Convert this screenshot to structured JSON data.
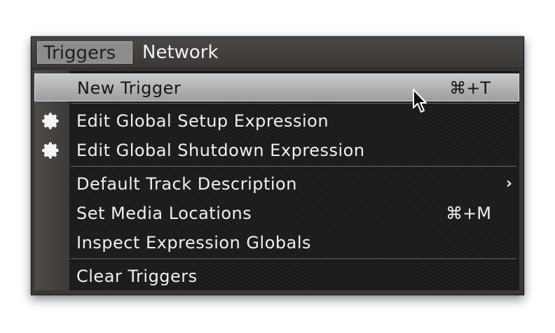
{
  "menubar": {
    "items": [
      {
        "label": "Triggers"
      },
      {
        "label": "Network"
      }
    ]
  },
  "menu": {
    "items": [
      {
        "label": "New Trigger",
        "shortcut": "⌘+T",
        "icon": "",
        "highlighted": true
      },
      {
        "label": "Edit Global Setup Expression",
        "shortcut": "",
        "icon": "gear-icon"
      },
      {
        "label": "Edit Global Shutdown Expression",
        "shortcut": "",
        "icon": "gear-icon"
      },
      {
        "label": "Default Track Description",
        "shortcut": "",
        "icon": "",
        "submenu_arrow": "›"
      },
      {
        "label": "Set Media Locations",
        "shortcut": "⌘+M",
        "icon": ""
      },
      {
        "label": "Inspect Expression Globals",
        "shortcut": "",
        "icon": ""
      },
      {
        "label": "Clear Triggers",
        "shortcut": "",
        "icon": ""
      }
    ]
  },
  "colors": {
    "menu_background": "#1a1816",
    "highlight": "#b5b5b5",
    "active_menubar_item": "#8e8c8a",
    "text": "#f0f0f0"
  }
}
